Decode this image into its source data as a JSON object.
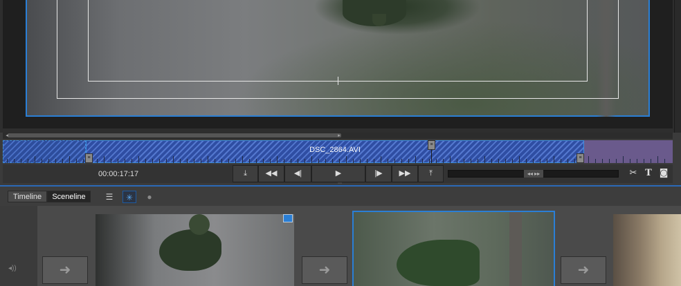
{
  "monitor": {
    "clip_name": "DSC_2864.AVI"
  },
  "transport": {
    "timecode": "00:00:17:17",
    "buttons": [
      "⤓",
      "◀◀",
      "◀|",
      "▶",
      "|▶",
      "▶▶",
      "⤒"
    ],
    "tools": {
      "split": "✂",
      "title": "T",
      "snapshot": "◙"
    },
    "jog_label": "◂◂ ▸▸"
  },
  "lower_panel": {
    "tabs": [
      "Timeline",
      "Sceneline"
    ],
    "active_tab": "Sceneline"
  },
  "colors": {
    "accent": "#2a7fd6",
    "clip": "#4c72c8",
    "post_clip": "#6a5a8c"
  }
}
